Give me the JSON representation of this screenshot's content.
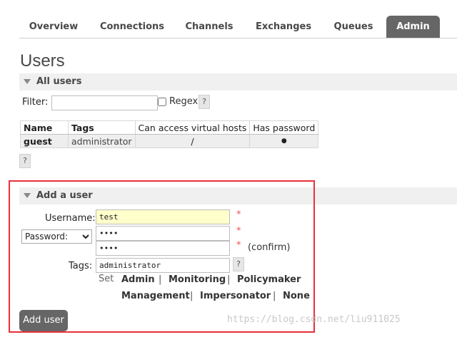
{
  "nav": {
    "tabs": [
      {
        "label": "Overview"
      },
      {
        "label": "Connections"
      },
      {
        "label": "Channels"
      },
      {
        "label": "Exchanges"
      },
      {
        "label": "Queues"
      },
      {
        "label": "Admin",
        "active": true
      }
    ]
  },
  "page_title": "Users",
  "all_users": {
    "heading": "All users",
    "filter_label": "Filter:",
    "filter_value": "",
    "regex_label": "Regex",
    "help": "?",
    "table": {
      "headers": [
        "Name",
        "Tags",
        "Can access virtual hosts",
        "Has password"
      ],
      "rows": [
        {
          "name": "guest",
          "tags": "administrator",
          "vhosts": "/",
          "has_password": "●"
        }
      ]
    },
    "table_help": "?"
  },
  "add_user": {
    "heading": "Add a user",
    "username_label": "Username:",
    "username_value": "test",
    "password_type": "Password:",
    "password_value": "••••",
    "confirm_value": "••••",
    "confirm_label": "(confirm)",
    "required_mark": "*",
    "tags_label": "Tags:",
    "tags_value": "administrator",
    "tags_help": "?",
    "set_label": "Set",
    "tag_options": [
      "Admin",
      "Monitoring",
      "Policymaker",
      "Management",
      "Impersonator",
      "None"
    ],
    "separator": "|",
    "submit_label": "Add user"
  },
  "watermark": "https://blog.csdn.net/liu911025",
  "colors": {
    "accent": "#666666",
    "highlight": "#ffffcc",
    "box": "#e8303a"
  }
}
